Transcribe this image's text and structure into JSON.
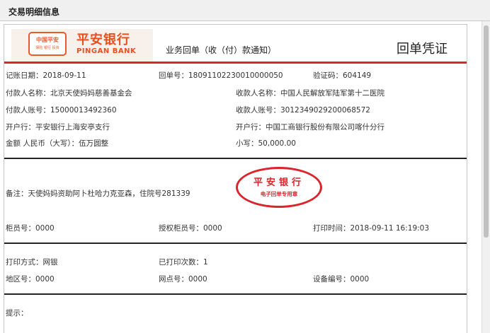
{
  "page": {
    "title": "交易明细信息"
  },
  "bank": {
    "logo_box_text": "中国平安",
    "logo_box_sub": "保险 银行 投资",
    "name_cn": "平安银行",
    "name_en": "PINGAN BANK"
  },
  "receipt": {
    "subtitle": "业务回单（收（付）款通知）",
    "title": "回单凭证",
    "fields": {
      "record_date_label": "记账日期：",
      "record_date": "2018-09-11",
      "receipt_no_label": "回单号：",
      "receipt_no": "18091102230010000050",
      "verify_code_label": "验证码：",
      "verify_code": "604149",
      "payer_name_label": "付款人名称：",
      "payer_name": "北京天使妈妈慈善基金会",
      "payee_name_label": "收款人名称：",
      "payee_name": "中国人民解放军陆军第十二医院",
      "payer_account_label": "付款人账号：",
      "payer_account": "15000013492360",
      "payee_account_label": "收款人账号：",
      "payee_account": "3012349029200068572",
      "payer_bank_label": "开户行：",
      "payer_bank": "平安银行上海安亭支行",
      "payee_bank_label": "开户行：",
      "payee_bank": "中国工商银行股份有限公司喀什分行",
      "amount_upper_label": "金额 人民币（大写）：",
      "amount_upper": "伍万圆整",
      "amount_lower_label": "小写：",
      "amount_lower": "50,000.00",
      "remark_label": "备注：",
      "remark": "天使妈妈资助阿卜杜哈力克亚森，住院号281339",
      "teller_no_label": "柜员号：",
      "teller_no": "0000",
      "auth_teller_label": "授权柜员号：",
      "auth_teller": "0000",
      "print_time_label": "打印时间：",
      "print_time": "2018-09-11 16:19:03",
      "print_method_label": "打印方式：",
      "print_method": "网银",
      "print_count_label": "已打印次数：",
      "print_count": "1",
      "region_no_label": "地区号：",
      "region_no": "0000",
      "branch_no_label": "网点号：",
      "branch_no": "0000",
      "device_no_label": "设备编号：",
      "device_no": "0000"
    },
    "stamp": {
      "title": "平安银行",
      "subtitle": "电子回单专用章"
    },
    "tips_label": "提示："
  },
  "colors": {
    "brand": "#e8501f",
    "stamp": "#d9252b",
    "rule": "#222222"
  }
}
